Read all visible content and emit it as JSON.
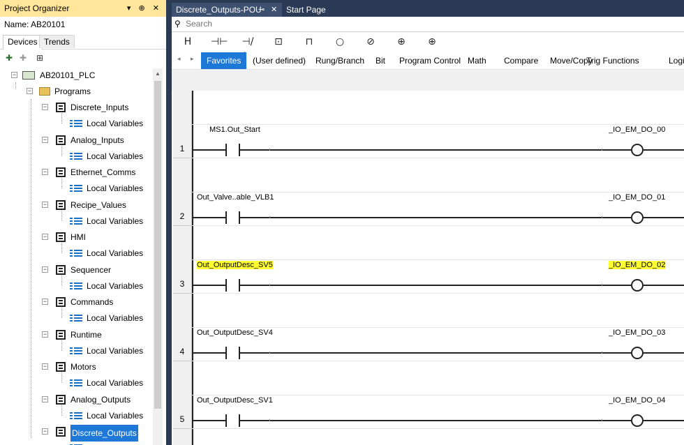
{
  "organizer": {
    "title": "Project Organizer",
    "controls": "▾ ⊕ ✕",
    "name_label": "Name:",
    "name_value": "AB20101",
    "tabs": [
      "Devices",
      "Trends"
    ],
    "tree": {
      "root": "AB20101_PLC",
      "programs": "Programs",
      "items": [
        {
          "label": "Discrete_Inputs",
          "child": "Local Variables"
        },
        {
          "label": "Analog_Inputs",
          "child": "Local Variables"
        },
        {
          "label": "Ethernet_Comms",
          "child": "Local Variables"
        },
        {
          "label": "Recipe_Values",
          "child": "Local Variables"
        },
        {
          "label": "HMI",
          "child": "Local Variables"
        },
        {
          "label": "Sequencer",
          "child": "Local Variables"
        },
        {
          "label": "Commands",
          "child": "Local Variables"
        },
        {
          "label": "Runtime",
          "child": "Local Variables"
        },
        {
          "label": "Motors",
          "child": "Local Variables"
        },
        {
          "label": "Analog_Outputs",
          "child": "Local Variables"
        },
        {
          "label": "Discrete_Outputs",
          "child": ""
        }
      ]
    }
  },
  "document": {
    "tabs": [
      "Discrete_Outputs-POU",
      "Start Page"
    ],
    "tab_pin": "⊸",
    "tab_close": "✕",
    "search_placeholder": "Search",
    "symbols": [
      "H",
      "⊣⊢",
      "⊣/⊢",
      "⊡",
      "⊓",
      "○",
      "⊘",
      "⊕",
      "⊕"
    ],
    "categories": [
      "Favorites",
      "(User defined)",
      "Rung/Branch",
      "Bit",
      "Program Control",
      "Math",
      "Compare",
      "Move/Copy",
      "Trig Functions",
      "Logic"
    ],
    "active_category": "Favorites"
  },
  "rungs": [
    {
      "number": "1",
      "contact": "MS1.Out_Start",
      "coil": "_IO_EM_DO_00",
      "highlight": false
    },
    {
      "number": "2",
      "contact": "Out_Valve..able_VLB1",
      "coil": "_IO_EM_DO_01",
      "highlight": false
    },
    {
      "number": "3",
      "contact": "Out_OutputDesc_SV5",
      "coil": "_IO_EM_DO_02",
      "highlight": true
    },
    {
      "number": "4",
      "contact": "Out_OutputDesc_SV4",
      "coil": "_IO_EM_DO_03",
      "highlight": false
    },
    {
      "number": "5",
      "contact": "Out_OutputDesc_SV1",
      "coil": "_IO_EM_DO_04",
      "highlight": false
    }
  ],
  "colors": {
    "accent": "#1e78d7",
    "title_bar": "#ffe69a",
    "highlight": "#ffff32",
    "tab_bar": "#2b3a55"
  }
}
